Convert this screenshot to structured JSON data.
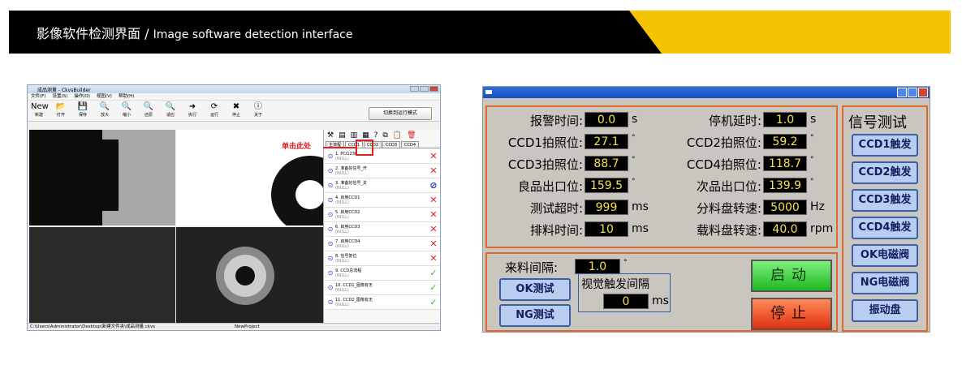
{
  "banner": {
    "title_cn": "影像软件检测界面",
    "sep": " / ",
    "title_en": "Image software detection interface"
  },
  "software": {
    "window_title": "成品测量 - CkvsBuilder",
    "menu": [
      "文件(F)",
      "设置(S)",
      "操作(O)",
      "视图(V)",
      "帮助(H)"
    ],
    "tools": [
      {
        "label": "新建",
        "icon": "New"
      },
      {
        "label": "打开",
        "icon": "📂"
      },
      {
        "label": "保存",
        "icon": "💾"
      },
      {
        "label": "放大",
        "icon": "🔍"
      },
      {
        "label": "缩小",
        "icon": "🔍"
      },
      {
        "label": "还原",
        "icon": "🔍"
      },
      {
        "label": "适应",
        "icon": "🔍"
      },
      {
        "label": "执行",
        "icon": "➜"
      },
      {
        "label": "运行",
        "icon": "⟳"
      },
      {
        "label": "停止",
        "icon": "✖"
      },
      {
        "label": "关于",
        "icon": "ⓘ"
      }
    ],
    "mode_button": "切换到运行模式",
    "tabs": [
      "主流程",
      "CCD1",
      "CCD2",
      "CCD3",
      "CCD4"
    ],
    "callout": "单击此处",
    "steps": [
      {
        "label": "1. PCI1230",
        "sub": "(NULL)",
        "mark": "✕",
        "cls": "red"
      },
      {
        "label": "2. 准备好信号_开",
        "sub": "(NULL)",
        "mark": "✕",
        "cls": "red"
      },
      {
        "label": "3. 准备好信号_关",
        "sub": "(NULL)",
        "mark": "⊘",
        "cls": "blue"
      },
      {
        "label": "4. 启用CCD1",
        "sub": "(NULL)",
        "mark": "✕",
        "cls": "red"
      },
      {
        "label": "5. 启用CCD2",
        "sub": "(NULL)",
        "mark": "✕",
        "cls": "red"
      },
      {
        "label": "6. 启用CCD3",
        "sub": "(NULL)",
        "mark": "✕",
        "cls": "red"
      },
      {
        "label": "7. 启用CCD4",
        "sub": "(NULL)",
        "mark": "✕",
        "cls": "red"
      },
      {
        "label": "8. 信号复位",
        "sub": "(NULL)",
        "mark": "✕",
        "cls": "red"
      },
      {
        "label": "9. CCD总流程",
        "sub": "(NULL)",
        "mark": "✓",
        "cls": "green"
      },
      {
        "label": "10. CCD1_图像有无",
        "sub": "(NULL)",
        "mark": "✓",
        "cls": "green"
      },
      {
        "label": "11. CCD2_图像有无",
        "sub": "(NULL)",
        "mark": "✓",
        "cls": "green"
      }
    ],
    "status_path": "C:\\Users\\Administrator\\Desktop\\新建文件夹\\成品测量.ckvs",
    "status_project": "NewProject"
  },
  "hmi": {
    "params_left": [
      {
        "label": "报警时间:",
        "value": "0.0",
        "unit": "s"
      },
      {
        "label": "CCD1拍照位:",
        "value": "27.1",
        "unit": "°"
      },
      {
        "label": "CCD3拍照位:",
        "value": "88.7",
        "unit": "°"
      },
      {
        "label": "良品出口位:",
        "value": "159.5",
        "unit": "°"
      },
      {
        "label": "测试超时:",
        "value": "999",
        "unit": "ms"
      },
      {
        "label": "排料时间:",
        "value": "10",
        "unit": "ms"
      }
    ],
    "params_right": [
      {
        "label": "停机延时:",
        "value": "1.0",
        "unit": "s"
      },
      {
        "label": "CCD2拍照位:",
        "value": "59.2",
        "unit": "°"
      },
      {
        "label": "CCD4拍照位:",
        "value": "118.7",
        "unit": "°"
      },
      {
        "label": "次品出口位:",
        "value": "139.9",
        "unit": "°"
      },
      {
        "label": "分料盘转速:",
        "value": "5000",
        "unit": "Hz"
      },
      {
        "label": "载料盘转速:",
        "value": "40.0",
        "unit": "rpm"
      }
    ],
    "feed_interval": {
      "label": "来料间隔:",
      "value": "1.0",
      "unit": "°"
    },
    "ok_test": "OK测试",
    "ng_test": "NG测试",
    "visual_trigger": {
      "label": "视觉触发间隔",
      "value": "0",
      "unit": "ms"
    },
    "start": "启动",
    "stop": "停止",
    "signal_title": "信号测试",
    "signal_buttons": [
      "CCD1触发",
      "CCD2触发",
      "CCD3触发",
      "CCD4触发",
      "OK电磁阀",
      "NG电磁阀",
      "振动盘"
    ]
  }
}
